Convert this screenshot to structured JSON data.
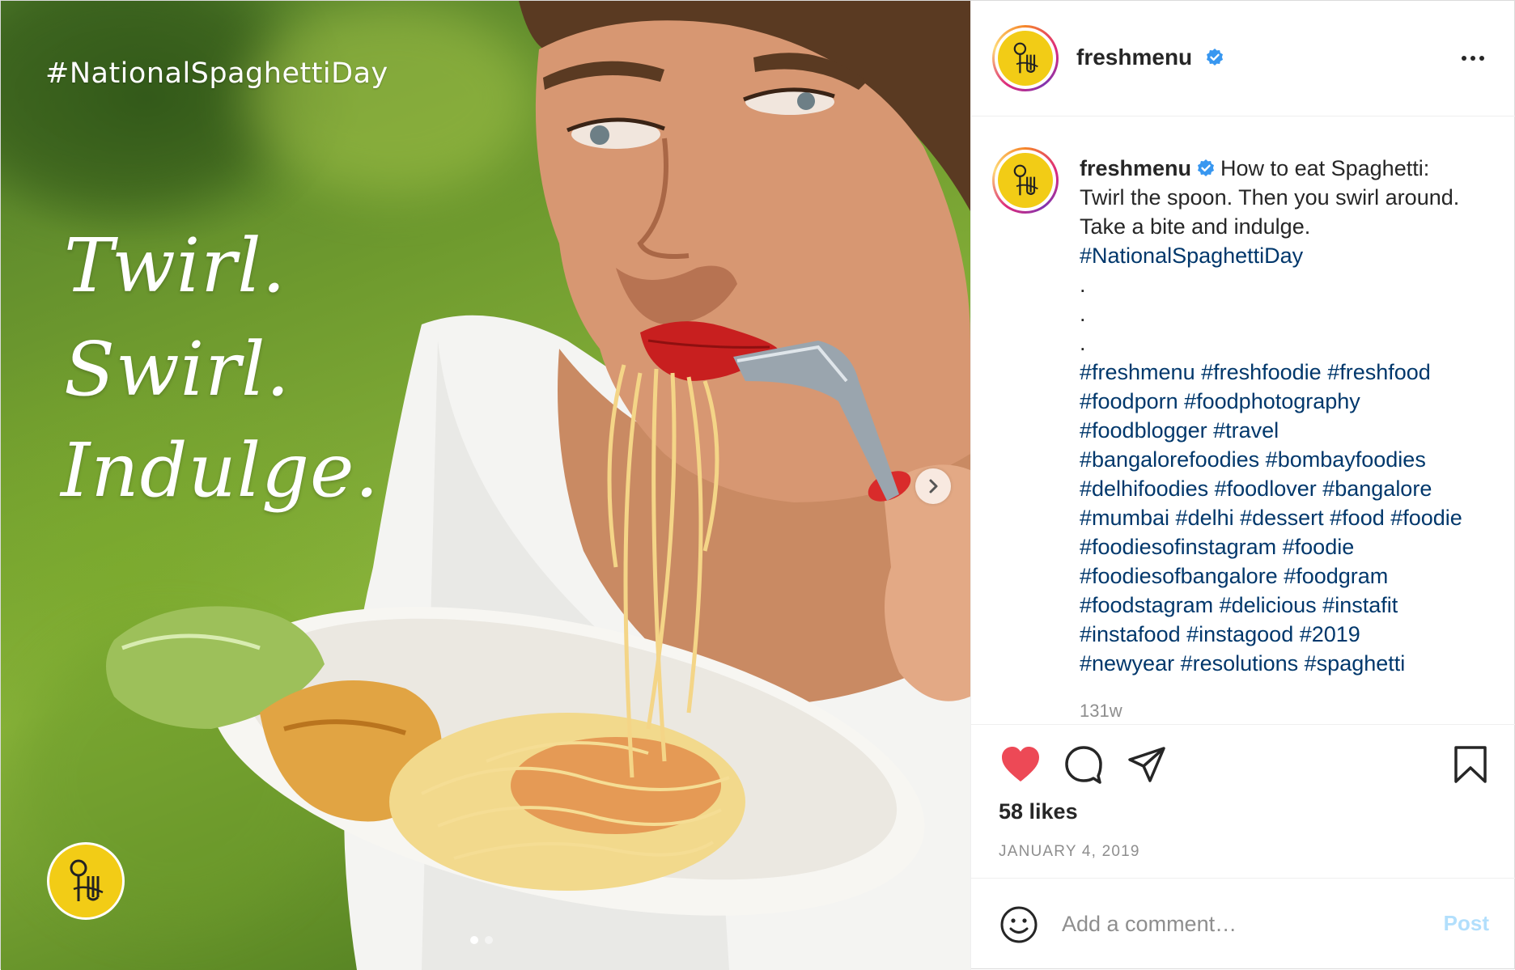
{
  "account": {
    "username": "freshmenu",
    "verified": true
  },
  "media": {
    "hashtag_overlay": "#NationalSpaghettiDay",
    "script_lines": [
      "Twirl.",
      "Swirl.",
      "Indulge."
    ],
    "carousel_dots": 2,
    "carousel_active_index": 0
  },
  "caption": {
    "username": "freshmenu",
    "text_lines": [
      "How to eat Spaghetti:",
      "Twirl the spoon. Then you swirl around.",
      "Take a bite and indulge."
    ],
    "hashtag_line": "#NationalSpaghettiDay",
    "dots": [
      ".",
      ".",
      "."
    ],
    "hashtag_rows": [
      "#freshmenu #freshfoodie #freshfood",
      "#foodporn #foodphotography",
      "#foodblogger #travel",
      "#bangalorefoodies #bombayfoodies",
      "#delhifoodies #foodlover #bangalore",
      "#mumbai #delhi #dessert #food #foodie",
      "#foodiesofinstagram #foodie",
      "#foodiesofbangalore #foodgram",
      "#foodstagram #delicious #instafit",
      "#instafood #instagood #2019",
      "#newyear #resolutions #spaghetti"
    ],
    "time_ago": "131w"
  },
  "actions": {
    "liked": true,
    "likes_label": "58 likes",
    "date": "JANUARY 4, 2019"
  },
  "comment": {
    "placeholder": "Add a comment…",
    "post_label": "Post"
  },
  "colors": {
    "like_red": "#ed4956",
    "hashtag_blue": "#00376b",
    "verified_blue": "#3897f0",
    "post_button_disabled": "#b2dffc",
    "brand_yellow": "#f2cc16"
  },
  "icons": [
    "more-icon",
    "verified-icon",
    "heart-icon",
    "comment-icon",
    "share-icon",
    "bookmark-icon",
    "emoji-icon",
    "chevron-right-icon",
    "freshmenu-logo"
  ]
}
